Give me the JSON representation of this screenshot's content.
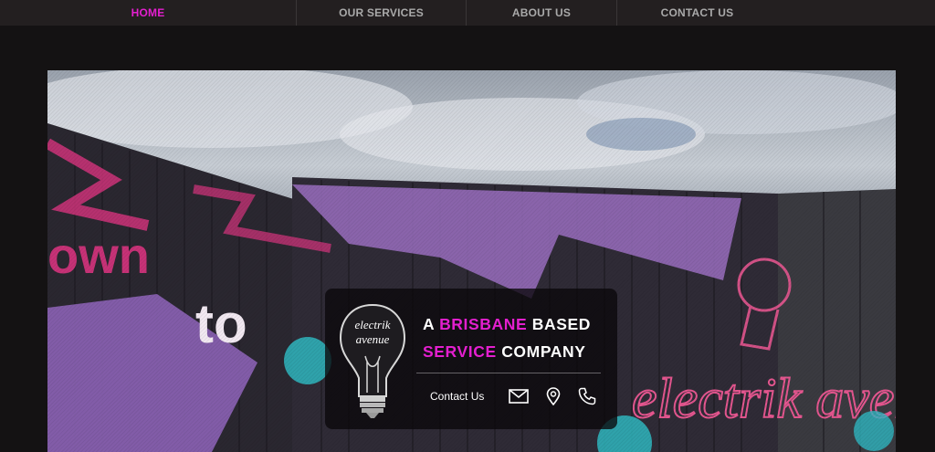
{
  "nav": {
    "items": [
      {
        "label": "HOME",
        "active": true
      },
      {
        "label": "OUR SERVICES",
        "active": false
      },
      {
        "label": "ABOUT US",
        "active": false
      },
      {
        "label": "CONTACT US",
        "active": false
      }
    ]
  },
  "hero": {
    "mural_text": [
      "own",
      "to",
      "electrik avenue"
    ]
  },
  "card": {
    "logo_text": [
      "electrik",
      "avenue"
    ],
    "headline": {
      "word1": "A",
      "word2": "BRISBANE",
      "word3": "BASED",
      "word4": "SERVICE",
      "word5": "COMPANY"
    },
    "contact_label": "Contact Us",
    "icons": [
      "envelope-icon",
      "map-pin-icon",
      "phone-icon"
    ]
  },
  "colors": {
    "accent": "#e41fcf",
    "nav_bg": "#231f20",
    "page_bg": "#141213",
    "nav_text": "#a9a9a9"
  }
}
